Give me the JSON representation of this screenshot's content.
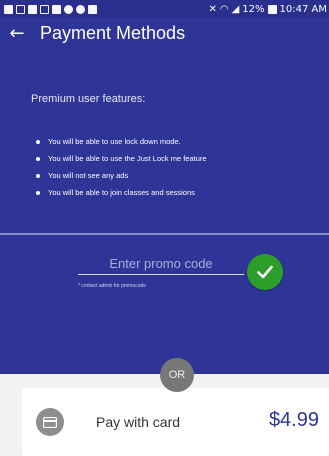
{
  "status_bar": {
    "battery": "12%",
    "time": "10:47 AM"
  },
  "header": {
    "title": "Payment Methods"
  },
  "premium": {
    "title": "Premium user features:",
    "features": [
      "You will be able to use lock down mode.",
      "You will be able to use the Just Lock me feature",
      "You will not see any ads",
      "You will be able to join classes and sessions"
    ]
  },
  "promo": {
    "placeholder": "Enter promo code",
    "hint": "* contact admin for promocode"
  },
  "separator": {
    "label": "OR"
  },
  "card_payment": {
    "label": "Pay with card",
    "price": "$4.99"
  },
  "colors": {
    "primary": "#2f3596",
    "accent_green": "#2e9e2a",
    "background": "#f2f2f2"
  },
  "icons": {
    "back": "arrow-left-icon",
    "apply": "check-icon",
    "card": "credit-card-icon"
  }
}
